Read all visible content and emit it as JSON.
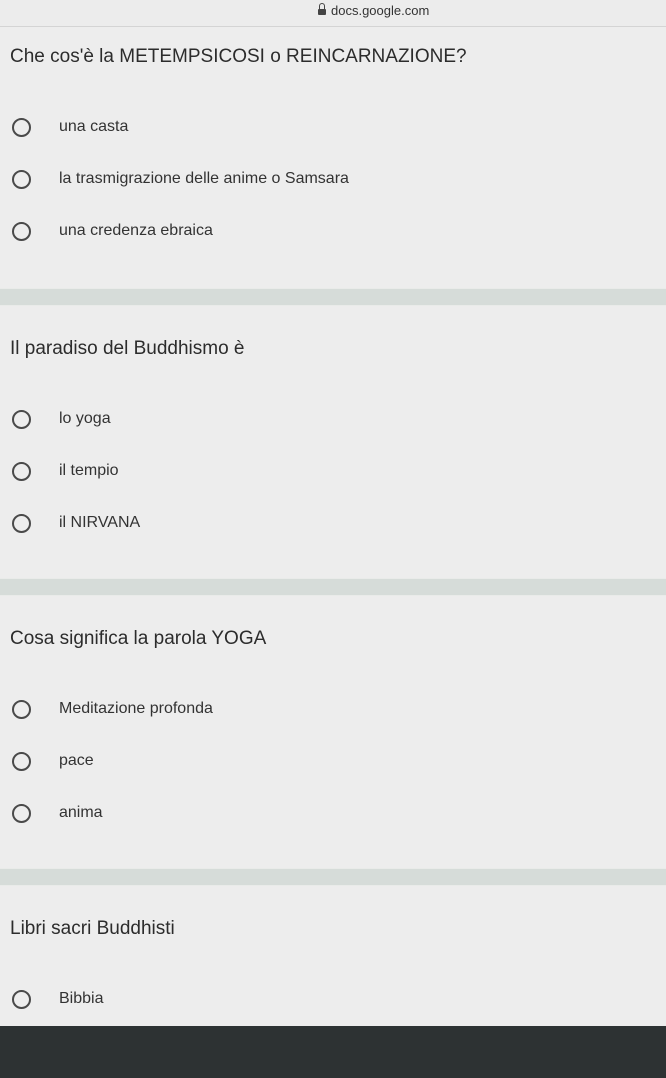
{
  "browser": {
    "url": "docs.google.com",
    "lock_icon": "lock-icon"
  },
  "questions": [
    {
      "text": "Che cos'è la METEMPSICOSI o REINCARNAZIONE?",
      "options": [
        "una casta",
        "la trasmigrazione delle anime o Samsara",
        "una credenza ebraica"
      ]
    },
    {
      "text": "Il paradiso del Buddhismo è",
      "options": [
        "lo yoga",
        "il tempio",
        "il NIRVANA"
      ]
    },
    {
      "text": "Cosa significa la parola YOGA",
      "options": [
        "Meditazione profonda",
        "pace",
        "anima"
      ]
    },
    {
      "text": "Libri sacri Buddhisti",
      "options": [
        "Bibbia"
      ]
    }
  ],
  "colors": {
    "card_background": "#ededed",
    "separator": "#d6dcd9",
    "bottom_bar": "#2d3233"
  }
}
